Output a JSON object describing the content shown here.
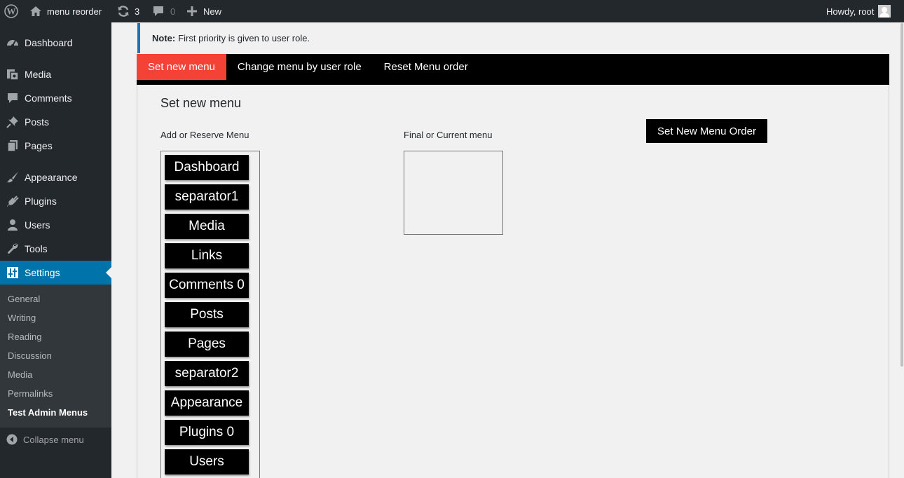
{
  "adminbar": {
    "site_name": "menu reorder",
    "updates_count": "3",
    "comments_count": "0",
    "new_label": "New",
    "greeting": "Howdy, root"
  },
  "sidebar": {
    "items": [
      {
        "label": "Dashboard",
        "icon": "dashboard-icon"
      },
      {
        "label": "Media",
        "icon": "media-icon"
      },
      {
        "label": "Comments",
        "icon": "comments-icon"
      },
      {
        "label": "Posts",
        "icon": "pin-icon"
      },
      {
        "label": "Pages",
        "icon": "pages-icon"
      },
      {
        "label": "Appearance",
        "icon": "brush-icon"
      },
      {
        "label": "Plugins",
        "icon": "plug-icon"
      },
      {
        "label": "Users",
        "icon": "user-icon"
      },
      {
        "label": "Tools",
        "icon": "wrench-icon"
      },
      {
        "label": "Settings",
        "icon": "settings-icon"
      }
    ],
    "submenu": [
      "General",
      "Writing",
      "Reading",
      "Discussion",
      "Media",
      "Permalinks",
      "Test Admin Menus"
    ],
    "collapse_label": "Collapse menu"
  },
  "notice": {
    "strong": "Note:",
    "text": "First priority is given to user role."
  },
  "tabs": [
    "Set new menu",
    "Change menu by user role",
    "Reset Menu order"
  ],
  "panel": {
    "title": "Set new menu",
    "reserve_label": "Add or Reserve Menu",
    "final_label": "Final or Current menu",
    "set_order_button": "Set New Menu Order",
    "reserve_items": [
      "Dashboard",
      "separator1",
      "Media",
      "Links",
      "Comments 0",
      "Posts",
      "Pages",
      "separator2",
      "Appearance",
      "Plugins 0",
      "Users"
    ]
  },
  "colors": {
    "admin_dark": "#23282d",
    "admin_blue": "#0073aa",
    "active_tab": "#f44336",
    "notice_border": "#2271b1"
  }
}
